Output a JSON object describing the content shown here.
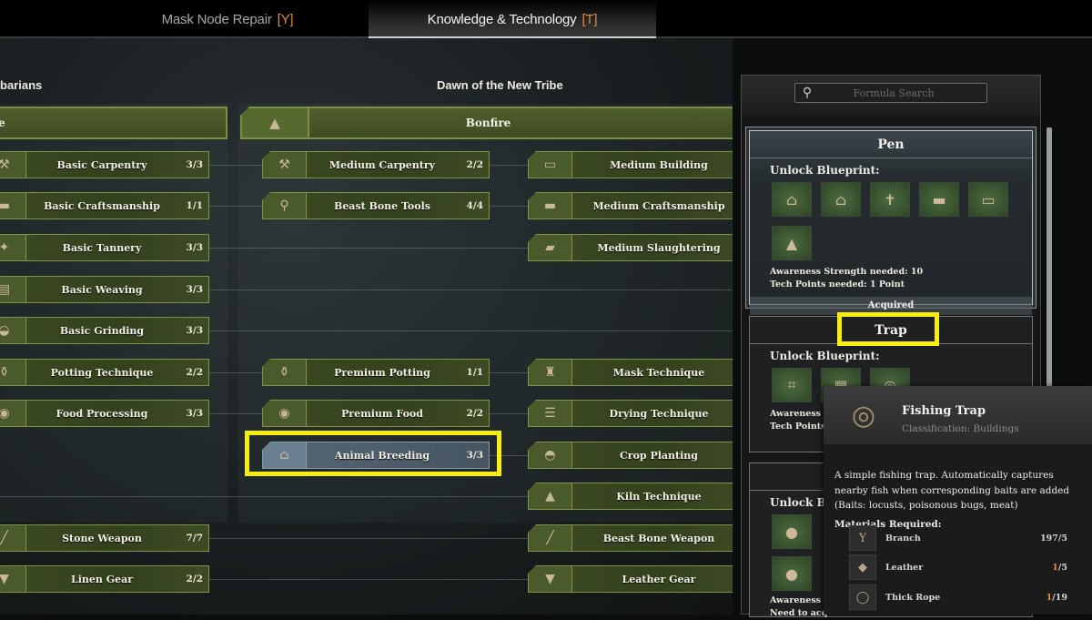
{
  "tabs": [
    {
      "label": "Mask Node Repair",
      "key": "[Y]",
      "active": false
    },
    {
      "label": "Knowledge & Technology",
      "key": "[T]",
      "active": true
    }
  ],
  "eras": [
    {
      "title": "barians",
      "bar_label": "e"
    },
    {
      "title": "Dawn of the New Tribe",
      "bar_label": "Bonfire",
      "bar_icon": "bonfire-icon"
    }
  ],
  "columns": {
    "left": [
      {
        "label": "Basic Carpentry",
        "count": "3/3",
        "icon": "carpentry-icon"
      },
      {
        "label": "Basic Craftsmanship",
        "count": "1/1",
        "icon": "workbench-icon"
      },
      {
        "label": "Basic Tannery",
        "count": "3/3",
        "icon": "tannery-icon"
      },
      {
        "label": "Basic Weaving",
        "count": "3/3",
        "icon": "loom-icon"
      },
      {
        "label": "Basic Grinding",
        "count": "3/3",
        "icon": "grinder-icon"
      },
      {
        "label": "Potting Technique",
        "count": "2/2",
        "icon": "pottery-icon"
      },
      {
        "label": "Food Processing",
        "count": "3/3",
        "icon": "food-icon"
      },
      {
        "label": "Stone Weapon",
        "count": "7/7",
        "icon": "spear-icon"
      },
      {
        "label": "Linen Gear",
        "count": "2/2",
        "icon": "armor-icon"
      }
    ],
    "middle": [
      {
        "label": "Medium Carpentry",
        "count": "2/2",
        "icon": "carpentry-icon"
      },
      {
        "label": "Beast Bone Tools",
        "count": "4/4",
        "icon": "axe-icon"
      },
      {
        "label": "Premium Potting",
        "count": "1/1",
        "icon": "pottery-icon"
      },
      {
        "label": "Premium Food",
        "count": "2/2",
        "icon": "food-icon"
      },
      {
        "label": "Animal Breeding",
        "count": "3/3",
        "icon": "pen-icon",
        "selected": true
      }
    ],
    "right": [
      {
        "label": "Medium Building",
        "icon": "table-icon"
      },
      {
        "label": "Medium Craftsmanship",
        "icon": "workbench-icon"
      },
      {
        "label": "Medium Slaughtering",
        "icon": "slaughter-icon"
      },
      {
        "label": "Mask Technique",
        "icon": "mask-icon"
      },
      {
        "label": "Drying Technique",
        "icon": "drying-rack-icon"
      },
      {
        "label": "Crop Planting",
        "icon": "mortar-icon"
      },
      {
        "label": "Kiln Technique",
        "icon": "kiln-icon"
      },
      {
        "label": "Beast Bone Weapon",
        "icon": "spear-icon"
      },
      {
        "label": "Leather Gear",
        "icon": "armor-icon"
      }
    ]
  },
  "panel": {
    "search_placeholder": "Formula Search",
    "cards": [
      {
        "title": "Pen",
        "unlock_label": "Unlock Blueprint:",
        "blueprints": [
          "pen-shelter-icon",
          "pen-shelter-icon",
          "scarecrow-icon",
          "trough-icon",
          "feeder-icon",
          "stump-icon"
        ],
        "awareness": "Awareness Strength needed: 10",
        "tech_points": "Tech Points needed: 1 Point",
        "status": "Acquired"
      },
      {
        "title": "Trap",
        "unlock_label": "Unlock Blueprint:",
        "blueprints": [
          "net-trap-icon",
          "cage-trap-icon",
          "fishing-trap-icon"
        ],
        "awareness": "Awareness",
        "tech_points": "Tech Points"
      },
      {
        "title": "",
        "unlock_label": "Unlock B",
        "blueprints": [
          "sack-icon",
          "sack-icon"
        ],
        "awareness": "Awareness",
        "tech_points": "Need to acq"
      }
    ]
  },
  "tooltip": {
    "name": "Fishing Trap",
    "classification": "Classification: Buildings",
    "description": "A simple fishing trap. Automatically captures nearby fish when corresponding baits are added (Baits: locusts, poisonous bugs, meat)",
    "materials_label": "Materials Required:",
    "materials": [
      {
        "name": "Branch",
        "have": "197",
        "need": "/5",
        "sufficient": true,
        "icon": "branch-icon"
      },
      {
        "name": "Leather",
        "have": "1",
        "need": "/5",
        "sufficient": false,
        "icon": "leather-icon"
      },
      {
        "name": "Thick Rope",
        "have": "1",
        "need": "/19",
        "sufficient": false,
        "icon": "rope-icon"
      }
    ]
  },
  "colors": {
    "highlight": "#f7ee10",
    "accent_key": "#e08a3c",
    "node_border": "#7f9448"
  }
}
